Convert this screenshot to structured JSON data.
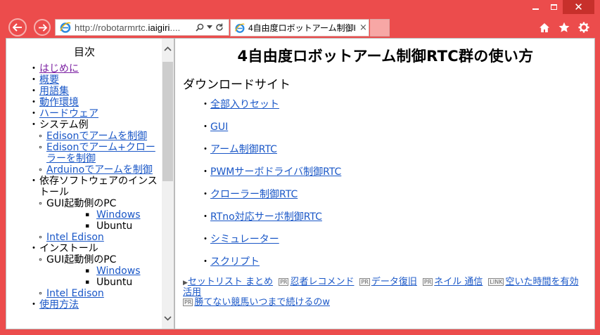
{
  "browser": {
    "url_host": "http://robotarmrtc.",
    "url_domain": "iaigiri",
    "url_rest": "....",
    "tab_title": "4自由度ロボットアーム制御R...",
    "tab_close": "×",
    "colors": {
      "frame": "#ec4c4c",
      "close": "#c7302b",
      "link": "#1a57c7",
      "visited": "#7b1fa2"
    },
    "icons": [
      "back-arrow-icon",
      "forward-arrow-icon",
      "ie-logo-icon",
      "search-icon",
      "dropdown-icon",
      "refresh-icon",
      "home-icon",
      "favorites-star-icon",
      "settings-gear-icon"
    ]
  },
  "toc": {
    "heading": "目次",
    "items": [
      {
        "label": "はじめに",
        "link": true,
        "visited": true
      },
      {
        "label": "概要",
        "link": true
      },
      {
        "label": "用語集",
        "link": true
      },
      {
        "label": "動作環境",
        "link": true
      },
      {
        "label": "ハードウェア",
        "link": true
      },
      {
        "label": "システム例",
        "link": false
      }
    ],
    "system_sub": [
      {
        "label": "Edisonでアームを制御"
      },
      {
        "label": "Edisonでアーム+クローラーを制御"
      },
      {
        "label": "Arduinoでアームを制御"
      }
    ],
    "deps": "依存ソフトウェアのインストール",
    "deps_gui": "GUI起動側のPC",
    "deps_windows": "Windows",
    "deps_ubuntu": "Ubuntu",
    "deps_edison": "Intel Edison",
    "install": "インストール",
    "install_gui": "GUI起動側のPC",
    "install_windows": "Windows",
    "install_ubuntu": "Ubuntu",
    "install_edison": "Intel Edison",
    "more": "使用方法"
  },
  "main": {
    "title": "4自由度ロボットアーム制御RTC群の使い方",
    "section": "ダウンロードサイト",
    "links": [
      "全部入りセット",
      "GUI",
      "アーム制御RTC",
      "PWMサーボドライバ制御RTC",
      "クローラー制御RTC",
      "RTno対応サーボ制御RTC",
      "シミュレーター",
      "スクリプト"
    ],
    "ads": {
      "first": "セットリスト まとめ",
      "pr1_tag": "PR",
      "pr1": "忍者レコメンド",
      "pr2_tag": "PR",
      "pr2": "データ復旧",
      "pr3_tag": "PR",
      "pr3": "ネイル 通信",
      "link_tag": "LINK",
      "link": "空いた時間を有効活用",
      "pr4_tag": "PR",
      "pr4": "勝てない競馬いつまで続けるのw"
    }
  }
}
